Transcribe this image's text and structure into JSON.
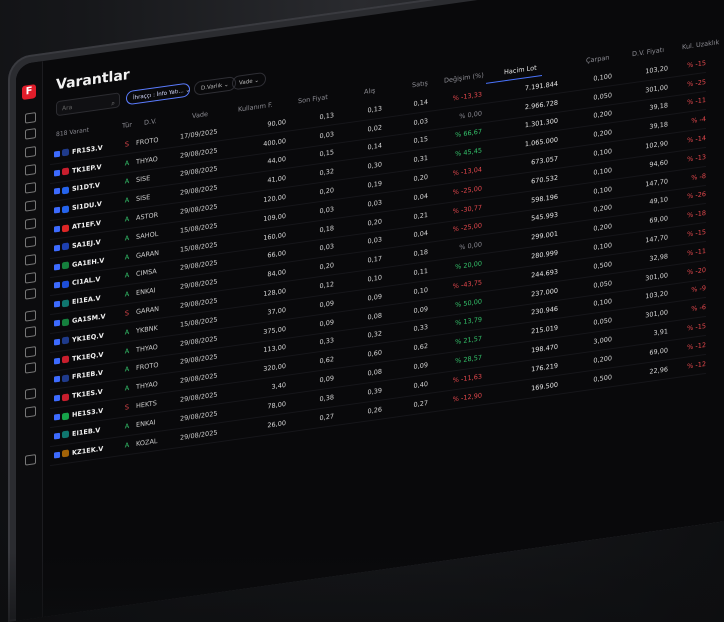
{
  "app": {
    "logo_letter": "F",
    "title": "Varantlar"
  },
  "search": {
    "placeholder": "Ara"
  },
  "filters": [
    {
      "label": "İhraççı : İnfo Yatı... ⌄",
      "active": true
    },
    {
      "label": "D.Varlık ⌄",
      "active": false
    },
    {
      "label": "Vade ⌄",
      "active": false
    }
  ],
  "count_label": "818 Varant",
  "columns": {
    "tur": "Tür",
    "dv": "D.V.",
    "vade": "Vade",
    "kullanim": "Kullanım F.",
    "son": "Son Fiyat",
    "alis": "Alış",
    "satis": "Satış",
    "degisim": "Değişim (%)",
    "hacim": "Hacim Lot",
    "carpan": "Çarpan",
    "dvfiyat": "D.V. Fiyatı",
    "kul": "Kul. Uzaklık"
  },
  "rail_icons": [
    "search-icon",
    "calendar-icon",
    "briefcase-icon",
    "layers-icon",
    "list-icon",
    "binoculars-icon",
    "monitor-icon",
    "cube-icon",
    "chart-icon",
    "globe-icon",
    "news-icon",
    "info-icon",
    "grid-icon",
    "document-icon",
    "download-icon",
    "table-icon",
    "clock-icon",
    "home-icon"
  ],
  "colors": {
    "accent": "#3d6bff",
    "up": "#34c26a",
    "down": "#e5484d",
    "logo": "#e11d2a"
  },
  "rows": [
    {
      "sym": "FR1S3.V",
      "tur": "S",
      "dv": "FROTO",
      "vade": "17/09/2025",
      "kul": "90,00",
      "son": "0,13",
      "alis": "0,13",
      "satis": "0,14",
      "deg": "% -13,33",
      "dir": "dn",
      "hacim": "7.191.844",
      "carpan": "0,100",
      "dvf": "103,20",
      "uz": "% -15",
      "icon": "#1f3a8a"
    },
    {
      "sym": "TK1EP.V",
      "tur": "A",
      "dv": "THYAO",
      "vade": "29/08/2025",
      "kul": "400,00",
      "son": "0,03",
      "alis": "0,02",
      "satis": "0,03",
      "deg": "% 0,00",
      "dir": "neu",
      "hacim": "2.966.728",
      "carpan": "0,050",
      "dvf": "301,00",
      "uz": "% -25",
      "icon": "#c81e2d"
    },
    {
      "sym": "SI1DT.V",
      "tur": "A",
      "dv": "SISE",
      "vade": "29/08/2025",
      "kul": "44,00",
      "son": "0,15",
      "alis": "0,14",
      "satis": "0,15",
      "deg": "% 66,67",
      "dir": "up",
      "hacim": "1.301.300",
      "carpan": "0,200",
      "dvf": "39,18",
      "uz": "% -11",
      "icon": "#2563eb"
    },
    {
      "sym": "SI1DU.V",
      "tur": "A",
      "dv": "SISE",
      "vade": "29/08/2025",
      "kul": "41,00",
      "son": "0,32",
      "alis": "0,30",
      "satis": "0,31",
      "deg": "% 45,45",
      "dir": "up",
      "hacim": "1.065.000",
      "carpan": "0,200",
      "dvf": "39,18",
      "uz": "% -4",
      "icon": "#2563eb"
    },
    {
      "sym": "AT1EF.V",
      "tur": "A",
      "dv": "ASTOR",
      "vade": "29/08/2025",
      "kul": "120,00",
      "son": "0,20",
      "alis": "0,19",
      "satis": "0,20",
      "deg": "% -13,04",
      "dir": "dn",
      "hacim": "673.057",
      "carpan": "0,100",
      "dvf": "102,90",
      "uz": "% -14",
      "icon": "#dc2626"
    },
    {
      "sym": "SA1EJ.V",
      "tur": "A",
      "dv": "SAHOL",
      "vade": "15/08/2025",
      "kul": "109,00",
      "son": "0,03",
      "alis": "0,03",
      "satis": "0,04",
      "deg": "% -25,00",
      "dir": "dn",
      "hacim": "670.532",
      "carpan": "0,100",
      "dvf": "94,60",
      "uz": "% -13",
      "icon": "#1e40af"
    },
    {
      "sym": "GA1EH.V",
      "tur": "A",
      "dv": "GARAN",
      "vade": "15/08/2025",
      "kul": "160,00",
      "son": "0,18",
      "alis": "0,20",
      "satis": "0,21",
      "deg": "% -30,77",
      "dir": "dn",
      "hacim": "598.196",
      "carpan": "0,100",
      "dvf": "147,70",
      "uz": "% -8",
      "icon": "#15803d"
    },
    {
      "sym": "CI1AL.V",
      "tur": "A",
      "dv": "CIMSA",
      "vade": "29/08/2025",
      "kul": "66,00",
      "son": "0,03",
      "alis": "0,03",
      "satis": "0,04",
      "deg": "% -25,00",
      "dir": "dn",
      "hacim": "545.993",
      "carpan": "0,200",
      "dvf": "49,10",
      "uz": "% -26",
      "icon": "#1d4ed8"
    },
    {
      "sym": "EI1EA.V",
      "tur": "A",
      "dv": "ENKAI",
      "vade": "29/08/2025",
      "kul": "84,00",
      "son": "0,20",
      "alis": "0,17",
      "satis": "0,18",
      "deg": "% 0,00",
      "dir": "neu",
      "hacim": "299.001",
      "carpan": "0,200",
      "dvf": "69,00",
      "uz": "% -18",
      "icon": "#0f766e"
    },
    {
      "sym": "GA1SM.V",
      "tur": "S",
      "dv": "GARAN",
      "vade": "29/08/2025",
      "kul": "128,00",
      "son": "0,12",
      "alis": "0,10",
      "satis": "0,11",
      "deg": "% 20,00",
      "dir": "up",
      "hacim": "280.999",
      "carpan": "0,100",
      "dvf": "147,70",
      "uz": "% -15",
      "icon": "#15803d"
    },
    {
      "sym": "YK1EQ.V",
      "tur": "A",
      "dv": "YKBNK",
      "vade": "15/08/2025",
      "kul": "37,00",
      "son": "0,09",
      "alis": "0,09",
      "satis": "0,10",
      "deg": "% -43,75",
      "dir": "dn",
      "hacim": "244.693",
      "carpan": "0,500",
      "dvf": "32,98",
      "uz": "% -11",
      "icon": "#1e3a8a"
    },
    {
      "sym": "TK1EQ.V",
      "tur": "A",
      "dv": "THYAO",
      "vade": "29/08/2025",
      "kul": "375,00",
      "son": "0,09",
      "alis": "0,08",
      "satis": "0,09",
      "deg": "% 50,00",
      "dir": "up",
      "hacim": "237.000",
      "carpan": "0,050",
      "dvf": "301,00",
      "uz": "% -20",
      "icon": "#c81e2d"
    },
    {
      "sym": "FR1EB.V",
      "tur": "A",
      "dv": "FROTO",
      "vade": "29/08/2025",
      "kul": "113,00",
      "son": "0,33",
      "alis": "0,32",
      "satis": "0,33",
      "deg": "% 13,79",
      "dir": "up",
      "hacim": "230.946",
      "carpan": "0,100",
      "dvf": "103,20",
      "uz": "% -9",
      "icon": "#1f3a8a"
    },
    {
      "sym": "TK1ES.V",
      "tur": "A",
      "dv": "THYAO",
      "vade": "29/08/2025",
      "kul": "320,00",
      "son": "0,62",
      "alis": "0,60",
      "satis": "0,62",
      "deg": "% 21,57",
      "dir": "up",
      "hacim": "215.019",
      "carpan": "0,050",
      "dvf": "301,00",
      "uz": "% -6",
      "icon": "#c81e2d"
    },
    {
      "sym": "HE1S3.V",
      "tur": "S",
      "dv": "HEKTS",
      "vade": "29/08/2025",
      "kul": "3,40",
      "son": "0,09",
      "alis": "0,08",
      "satis": "0,09",
      "deg": "% 28,57",
      "dir": "up",
      "hacim": "198.470",
      "carpan": "3,000",
      "dvf": "3,91",
      "uz": "% -15",
      "icon": "#16a34a"
    },
    {
      "sym": "EI1EB.V",
      "tur": "A",
      "dv": "ENKAI",
      "vade": "29/08/2025",
      "kul": "78,00",
      "son": "0,38",
      "alis": "0,39",
      "satis": "0,40",
      "deg": "% -11,63",
      "dir": "dn",
      "hacim": "176.219",
      "carpan": "0,200",
      "dvf": "69,00",
      "uz": "% -12",
      "icon": "#0f766e"
    },
    {
      "sym": "KZ1EK.V",
      "tur": "A",
      "dv": "KOZAL",
      "vade": "29/08/2025",
      "kul": "26,00",
      "son": "0,27",
      "alis": "0,26",
      "satis": "0,27",
      "deg": "% -12,90",
      "dir": "dn",
      "hacim": "169.500",
      "carpan": "0,500",
      "dvf": "22,96",
      "uz": "% -12",
      "icon": "#a16207"
    }
  ]
}
